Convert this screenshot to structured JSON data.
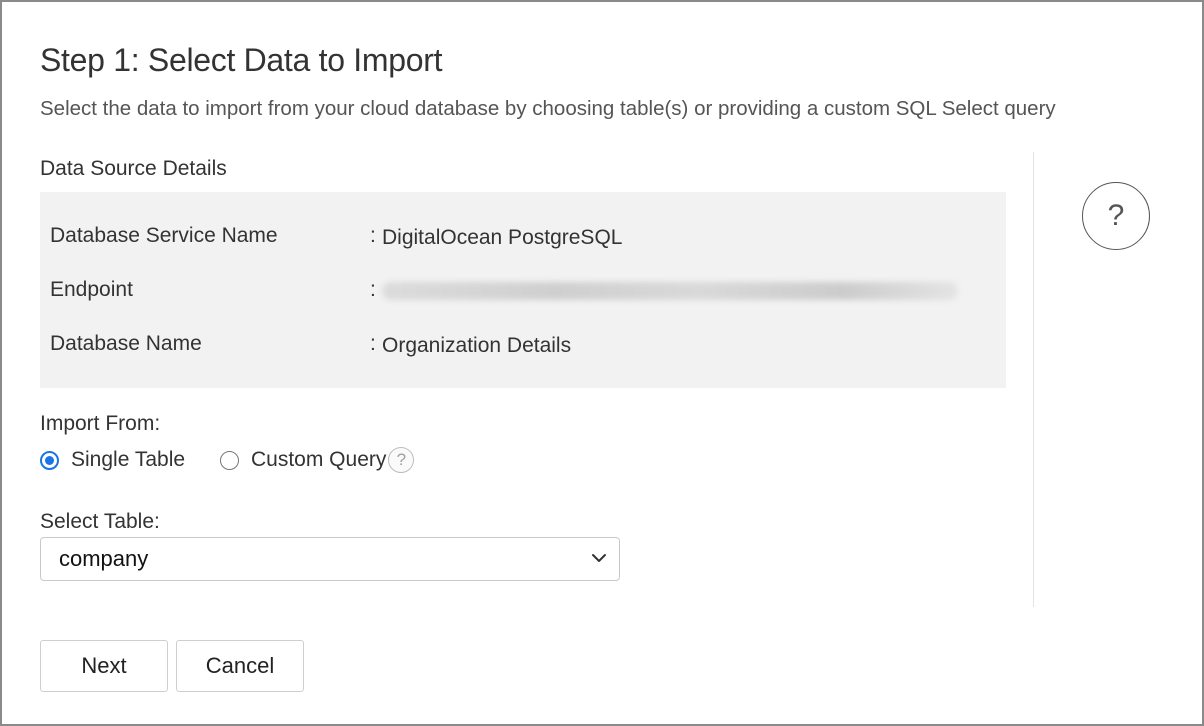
{
  "header": {
    "title": "Step 1: Select Data to Import",
    "subtitle": "Select the data to import from your cloud database by choosing table(s) or providing a custom SQL Select query"
  },
  "details": {
    "section_title": "Data Source Details",
    "separator": ":",
    "rows": [
      {
        "label": "Database Service Name",
        "value": "DigitalOcean PostgreSQL"
      },
      {
        "label": "Endpoint",
        "value": ""
      },
      {
        "label": "Database Name",
        "value": "Organization Details"
      }
    ]
  },
  "help": {
    "symbol": "?",
    "small_symbol": "?"
  },
  "import_from": {
    "label": "Import From:",
    "options": [
      {
        "label": "Single Table",
        "selected": true
      },
      {
        "label": "Custom Query",
        "selected": false
      }
    ]
  },
  "select_table": {
    "label": "Select Table:",
    "value": "company"
  },
  "buttons": {
    "next": "Next",
    "cancel": "Cancel"
  },
  "colors": {
    "accent": "#1a73e8",
    "panel_bg": "#f2f2f2",
    "border": "#8a8a8a"
  }
}
